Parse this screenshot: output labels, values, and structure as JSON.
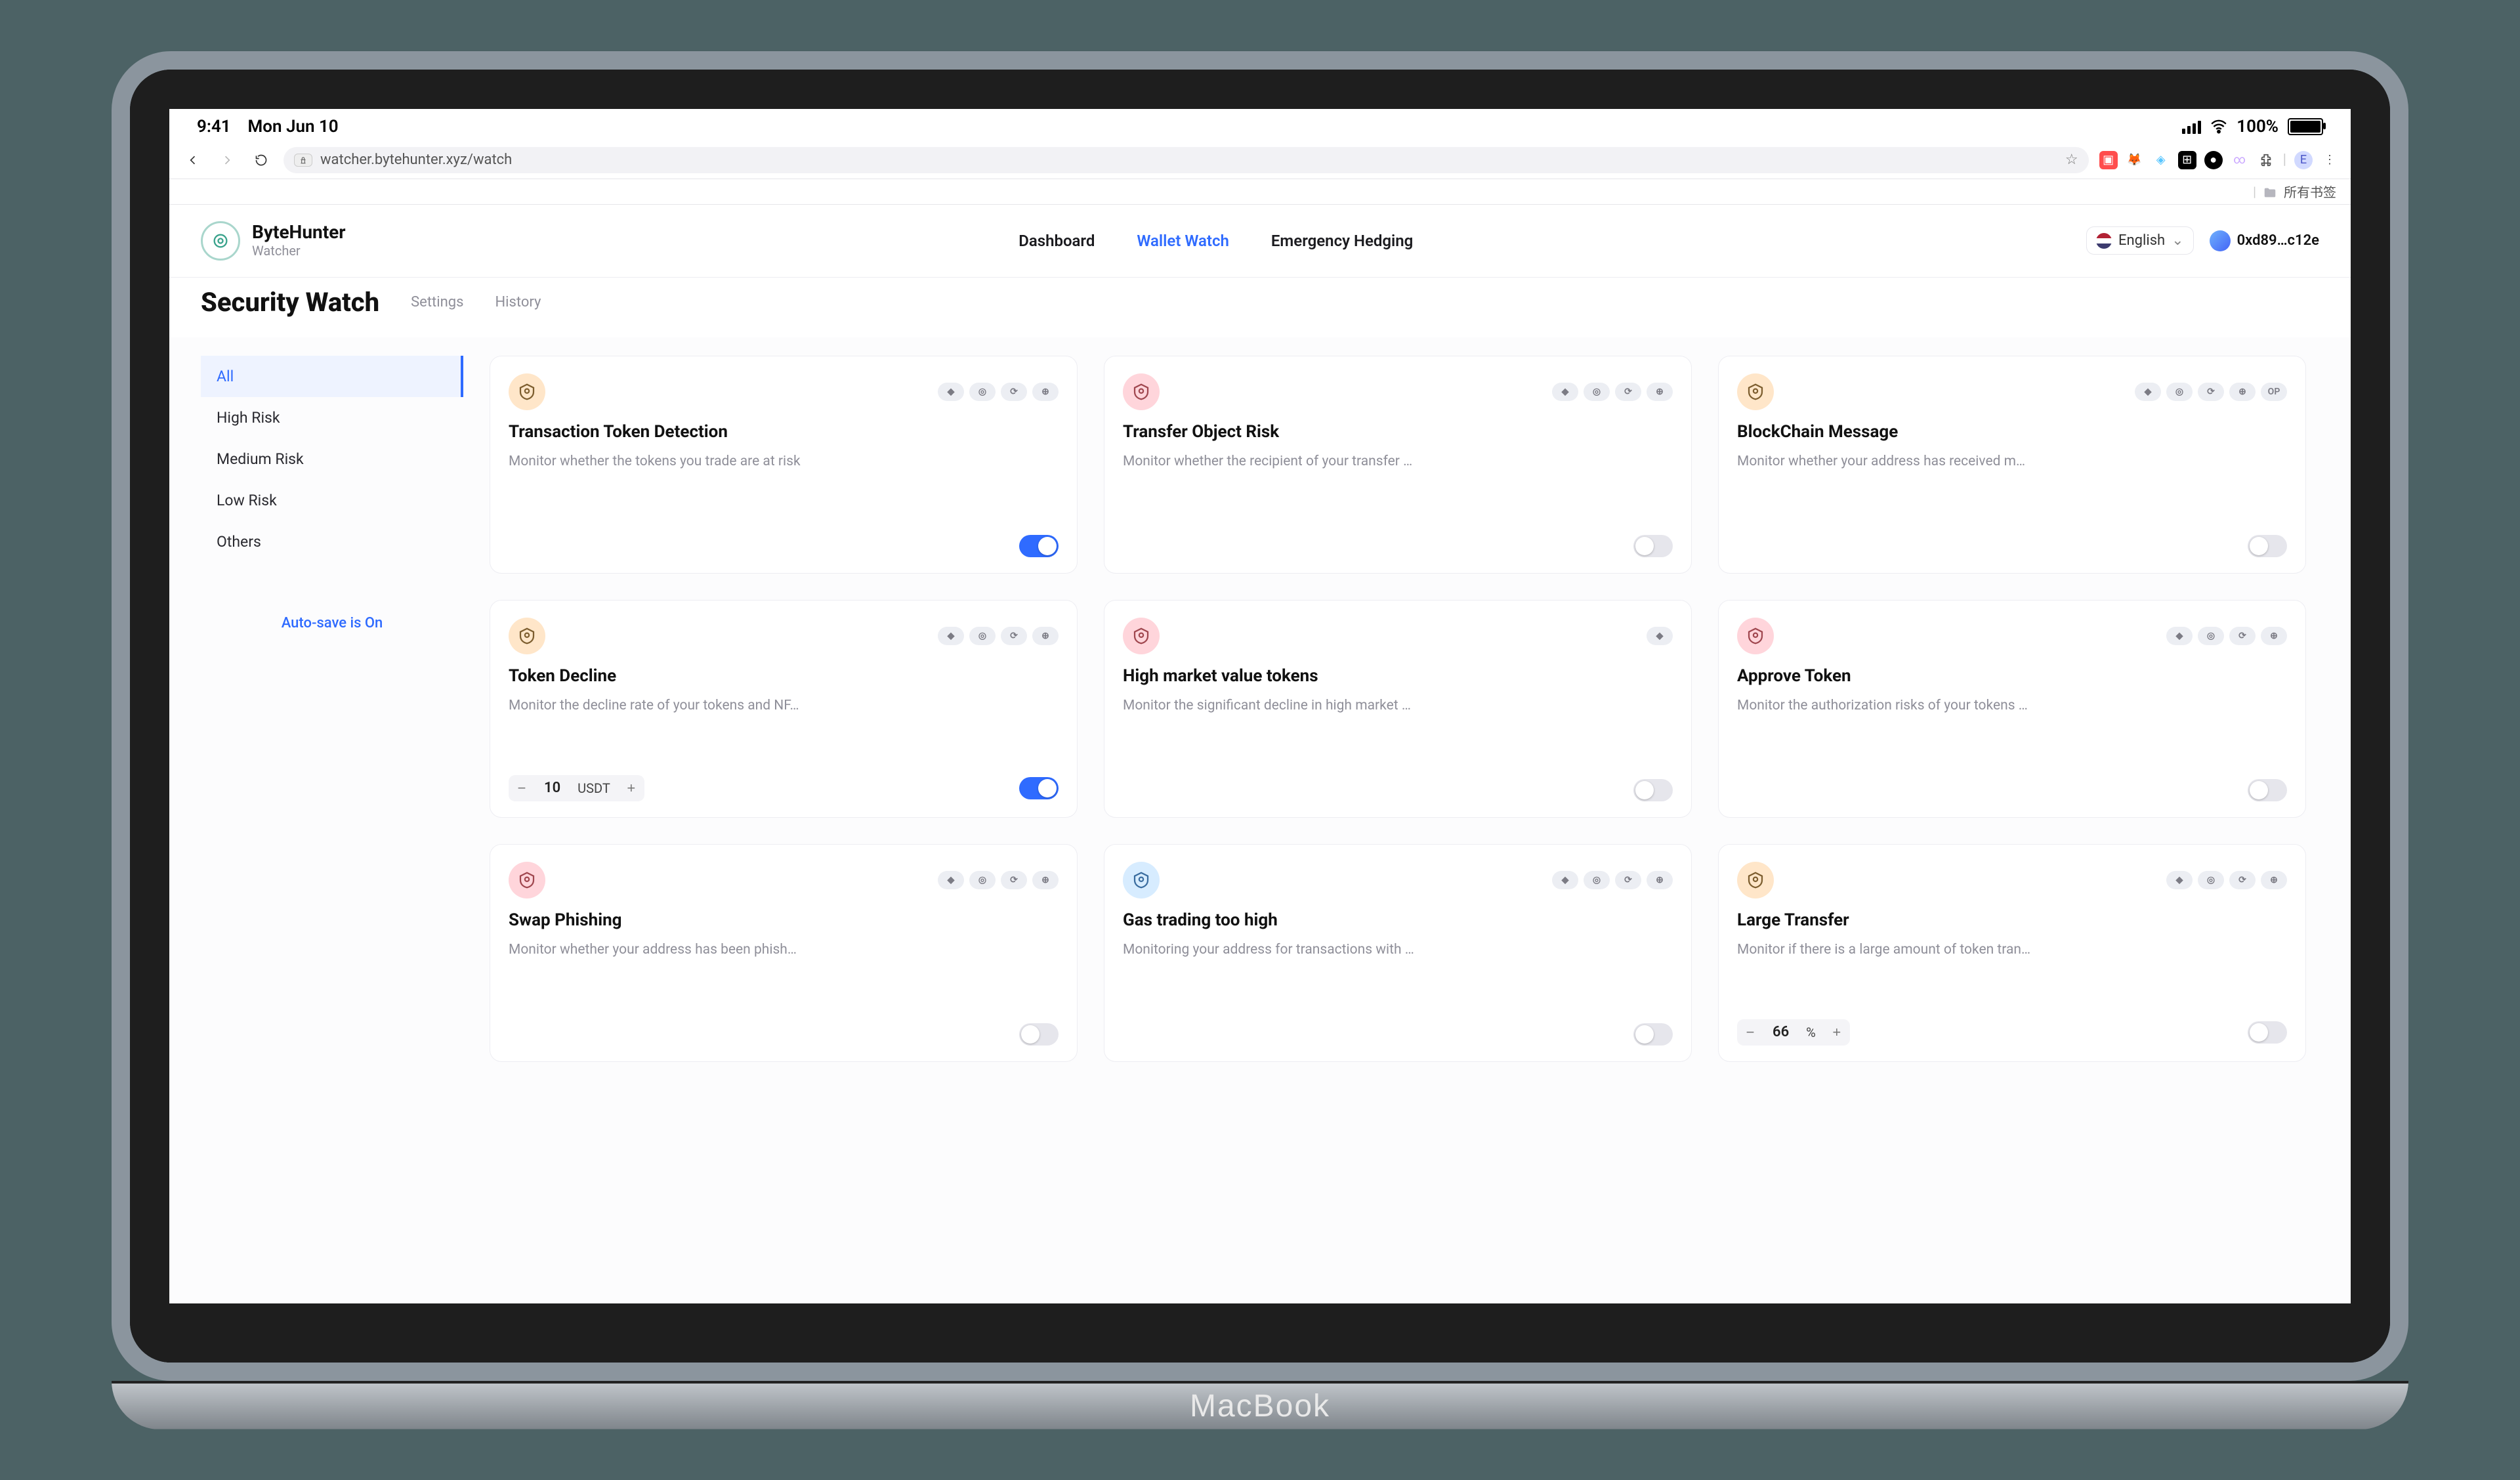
{
  "device": {
    "status_time": "9:41",
    "status_date": "Mon Jun 10",
    "battery_pct": "100%",
    "base_label": "MacBook"
  },
  "browser": {
    "url": "watcher.bytehunter.xyz/watch",
    "bookmark_folder": "所有书签"
  },
  "header": {
    "brand_name": "ByteHunter",
    "brand_sub": "Watcher",
    "nav": [
      {
        "label": "Dashboard",
        "active": false
      },
      {
        "label": "Wallet Watch",
        "active": true
      },
      {
        "label": "Emergency Hedging",
        "active": false
      }
    ],
    "language": "English",
    "wallet_address": "0xd89…c12e"
  },
  "subheader": {
    "title": "Security Watch",
    "links": [
      {
        "label": "Settings"
      },
      {
        "label": "History"
      }
    ]
  },
  "sidebar": {
    "items": [
      {
        "label": "All",
        "active": true
      },
      {
        "label": "High Risk",
        "active": false
      },
      {
        "label": "Medium Risk",
        "active": false
      },
      {
        "label": "Low Risk",
        "active": false
      },
      {
        "label": "Others",
        "active": false
      }
    ],
    "autosave_label": "Auto-save is On"
  },
  "cards": [
    {
      "title": "Transaction Token Detection",
      "desc": "Monitor whether the tokens you trade are at risk",
      "icon_color": "peach",
      "chips": [
        "◆",
        "◎",
        "⟳",
        "⊕"
      ],
      "toggle_on": true
    },
    {
      "title": "Transfer Object Risk",
      "desc": "Monitor whether the recipient of your transfer …",
      "icon_color": "pink",
      "chips": [
        "◆",
        "◎",
        "⟳",
        "⊕"
      ],
      "toggle_on": false
    },
    {
      "title": "BlockChain Message",
      "desc": "Monitor whether your address has received m…",
      "icon_color": "peach",
      "chips": [
        "◆",
        "◎",
        "⟳",
        "⊕",
        "OP"
      ],
      "toggle_on": false
    },
    {
      "title": "Token Decline",
      "desc": "Monitor the decline rate of your tokens and NF…",
      "icon_color": "peach",
      "chips": [
        "◆",
        "◎",
        "⟳",
        "⊕"
      ],
      "stepper": {
        "value": "10",
        "unit": "USDT"
      },
      "toggle_on": true
    },
    {
      "title": "High market value tokens",
      "desc": "Monitor the significant decline in high market …",
      "icon_color": "pink",
      "chips": [
        "◆"
      ],
      "toggle_on": false
    },
    {
      "title": "Approve Token",
      "desc": "Monitor the authorization risks of your tokens …",
      "icon_color": "pink",
      "chips": [
        "◆",
        "◎",
        "⟳",
        "⊕"
      ],
      "toggle_on": false
    },
    {
      "title": "Swap Phishing",
      "desc": "Monitor whether your address has been phish…",
      "icon_color": "pink",
      "chips": [
        "◆",
        "◎",
        "⟳",
        "⊕"
      ],
      "toggle_on": false
    },
    {
      "title": "Gas trading too high",
      "desc": "Monitoring your address for transactions with …",
      "icon_color": "blue",
      "chips": [
        "◆",
        "◎",
        "⟳",
        "⊕"
      ],
      "toggle_on": false
    },
    {
      "title": "Large Transfer",
      "desc": "Monitor if there is a large amount of token tran…",
      "icon_color": "peach",
      "chips": [
        "◆",
        "◎",
        "⟳",
        "⊕"
      ],
      "stepper": {
        "value": "66",
        "unit": "%"
      },
      "toggle_on": false
    }
  ]
}
